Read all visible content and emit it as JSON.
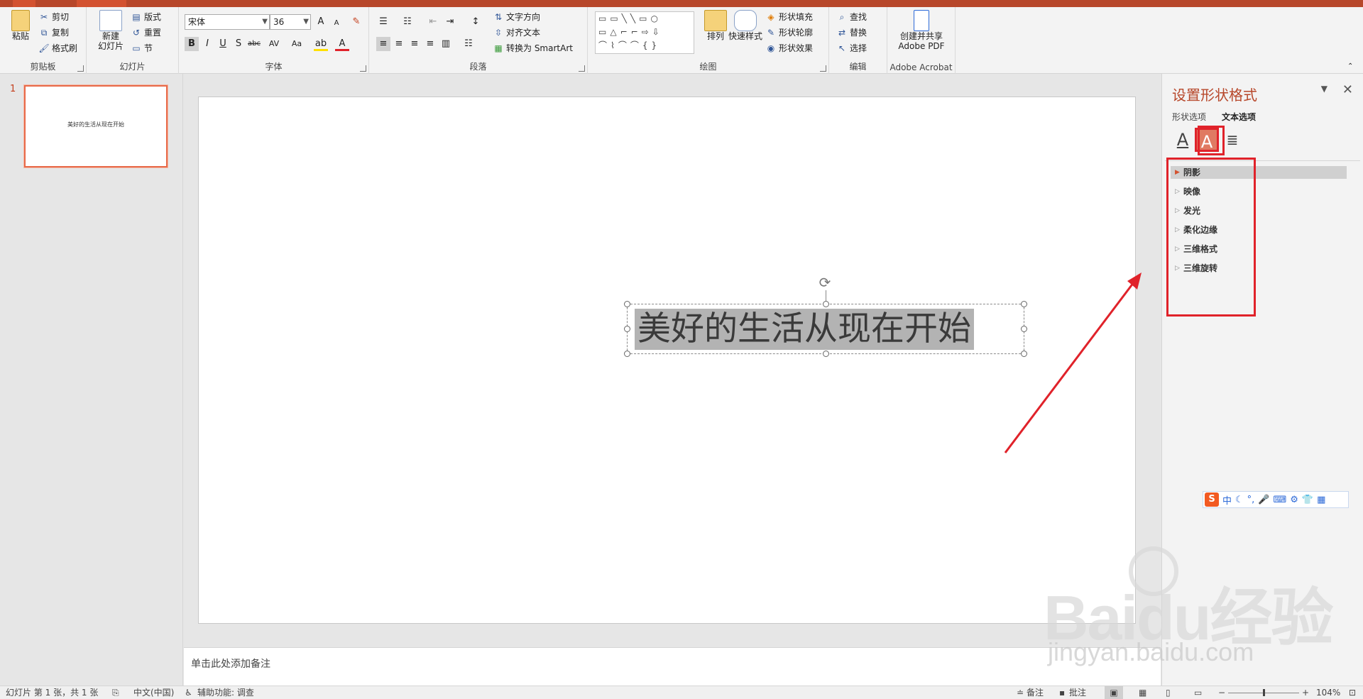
{
  "ribbon": {
    "clipboard": {
      "paste": "粘贴",
      "cut": "剪切",
      "copy": "复制",
      "format_painter": "格式刷",
      "label": "剪贴板"
    },
    "slides": {
      "new_slide": "新建",
      "new_slide2": "幻灯片",
      "layout": "版式",
      "reset": "重置",
      "section": "节",
      "label": "幻灯片"
    },
    "font": {
      "name": "宋体",
      "size": "36",
      "label": "字体",
      "bold": "B",
      "italic": "I",
      "underline": "U",
      "shadow": "S",
      "strike": "abc",
      "spacing": "AV",
      "case": "Aa",
      "grow": "A",
      "shrink": "A"
    },
    "paragraph": {
      "text_direction": "文字方向",
      "align_text": "对齐文本",
      "smartart": "转换为 SmartArt",
      "label": "段落"
    },
    "drawing": {
      "arrange": "排列",
      "quick_styles": "快速样式",
      "fill": "形状填充",
      "outline": "形状轮廓",
      "effects": "形状效果",
      "label": "绘图"
    },
    "editing": {
      "find": "查找",
      "replace": "替换",
      "select": "选择",
      "label": "编辑"
    },
    "acrobat": {
      "create": "创建并共享",
      "pdf": "Adobe PDF",
      "label": "Adobe Acrobat"
    }
  },
  "thumbnails": {
    "number": "1",
    "text": "美好的生活从现在开始"
  },
  "slide": {
    "text": "美好的生活从现在开始"
  },
  "notes": {
    "placeholder": "单击此处添加备注"
  },
  "format_pane": {
    "title": "设置形状格式",
    "tabs": [
      "形状选项",
      "文本选项"
    ],
    "icons": [
      "A",
      "A",
      "≣"
    ],
    "sections": [
      "阴影",
      "映像",
      "发光",
      "柔化边缘",
      "三维格式",
      "三维旋转"
    ]
  },
  "ime": {
    "items": [
      "中",
      "☾",
      "°,",
      "🎤",
      "⌨",
      "⚙",
      "👕",
      "▦"
    ]
  },
  "status": {
    "slide_info": "幻灯片 第 1 张，共 1 张",
    "language": "中文(中国)",
    "accessibility": "辅助功能: 调查",
    "notes": "备注",
    "comments": "批注",
    "zoom": "104%"
  },
  "watermark": {
    "brand": "Baidu经验",
    "url": "jingyan.baidu.com"
  },
  "colors": {
    "accent": "#b7472a",
    "highlight": "#e0222a"
  }
}
